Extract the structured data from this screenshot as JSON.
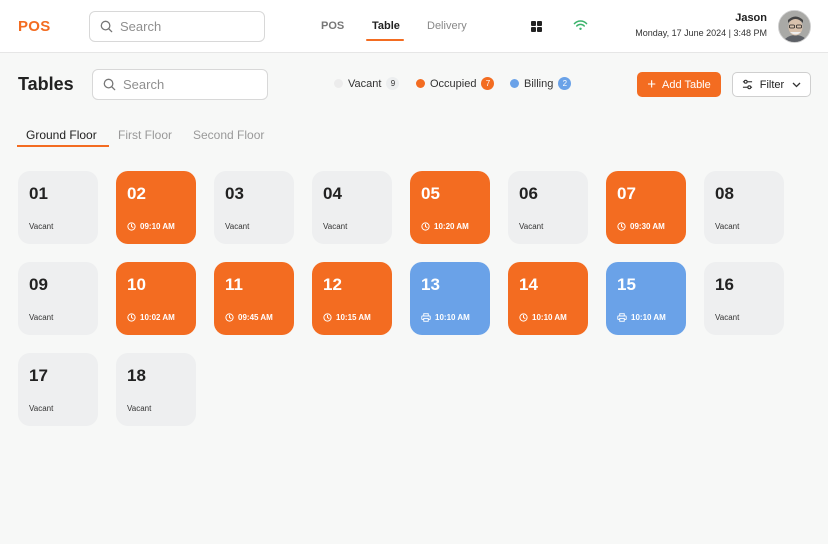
{
  "app": {
    "logo": "POS"
  },
  "header": {
    "search_placeholder": "Search",
    "nav": [
      {
        "label": "POS"
      },
      {
        "label": "Table"
      },
      {
        "label": "Delivery"
      }
    ],
    "active_nav": "Table",
    "user": {
      "name": "Jason",
      "datetime": "Monday, 17 June 2024 | 3:48 PM"
    },
    "icons": [
      "grid-icon",
      "wifi-icon",
      "avatar"
    ]
  },
  "page": {
    "title": "Tables",
    "search_placeholder": "Search",
    "legend": [
      {
        "label": "Vacant",
        "count": "9",
        "color": "#eeeff0"
      },
      {
        "label": "Occupied",
        "count": "7",
        "color": "#f36c21"
      },
      {
        "label": "Billing",
        "count": "2",
        "color": "#6aa2e8"
      }
    ],
    "add_button": "Add Table",
    "filter_button": "Filter"
  },
  "floors": [
    {
      "label": "Ground Floor",
      "active": true
    },
    {
      "label": "First Floor",
      "active": false
    },
    {
      "label": "Second Floor",
      "active": false
    }
  ],
  "tables": [
    {
      "number": "01",
      "status": "vacant",
      "label": "Vacant"
    },
    {
      "number": "02",
      "status": "occupied",
      "label": "09:10 AM"
    },
    {
      "number": "03",
      "status": "vacant",
      "label": "Vacant"
    },
    {
      "number": "04",
      "status": "vacant",
      "label": "Vacant"
    },
    {
      "number": "05",
      "status": "occupied",
      "label": "10:20 AM"
    },
    {
      "number": "06",
      "status": "vacant",
      "label": "Vacant"
    },
    {
      "number": "07",
      "status": "occupied",
      "label": "09:30 AM"
    },
    {
      "number": "08",
      "status": "vacant",
      "label": "Vacant"
    },
    {
      "number": "09",
      "status": "vacant",
      "label": "Vacant"
    },
    {
      "number": "10",
      "status": "occupied",
      "label": "10:02 AM"
    },
    {
      "number": "11",
      "status": "occupied",
      "label": "09:45 AM"
    },
    {
      "number": "12",
      "status": "occupied",
      "label": "10:15 AM"
    },
    {
      "number": "13",
      "status": "billing",
      "label": "10:10 AM"
    },
    {
      "number": "14",
      "status": "occupied",
      "label": "10:10 AM"
    },
    {
      "number": "15",
      "status": "billing",
      "label": "10:10 AM"
    },
    {
      "number": "16",
      "status": "vacant",
      "label": "Vacant"
    },
    {
      "number": "17",
      "status": "vacant",
      "label": "Vacant"
    },
    {
      "number": "18",
      "status": "vacant",
      "label": "Vacant"
    }
  ]
}
